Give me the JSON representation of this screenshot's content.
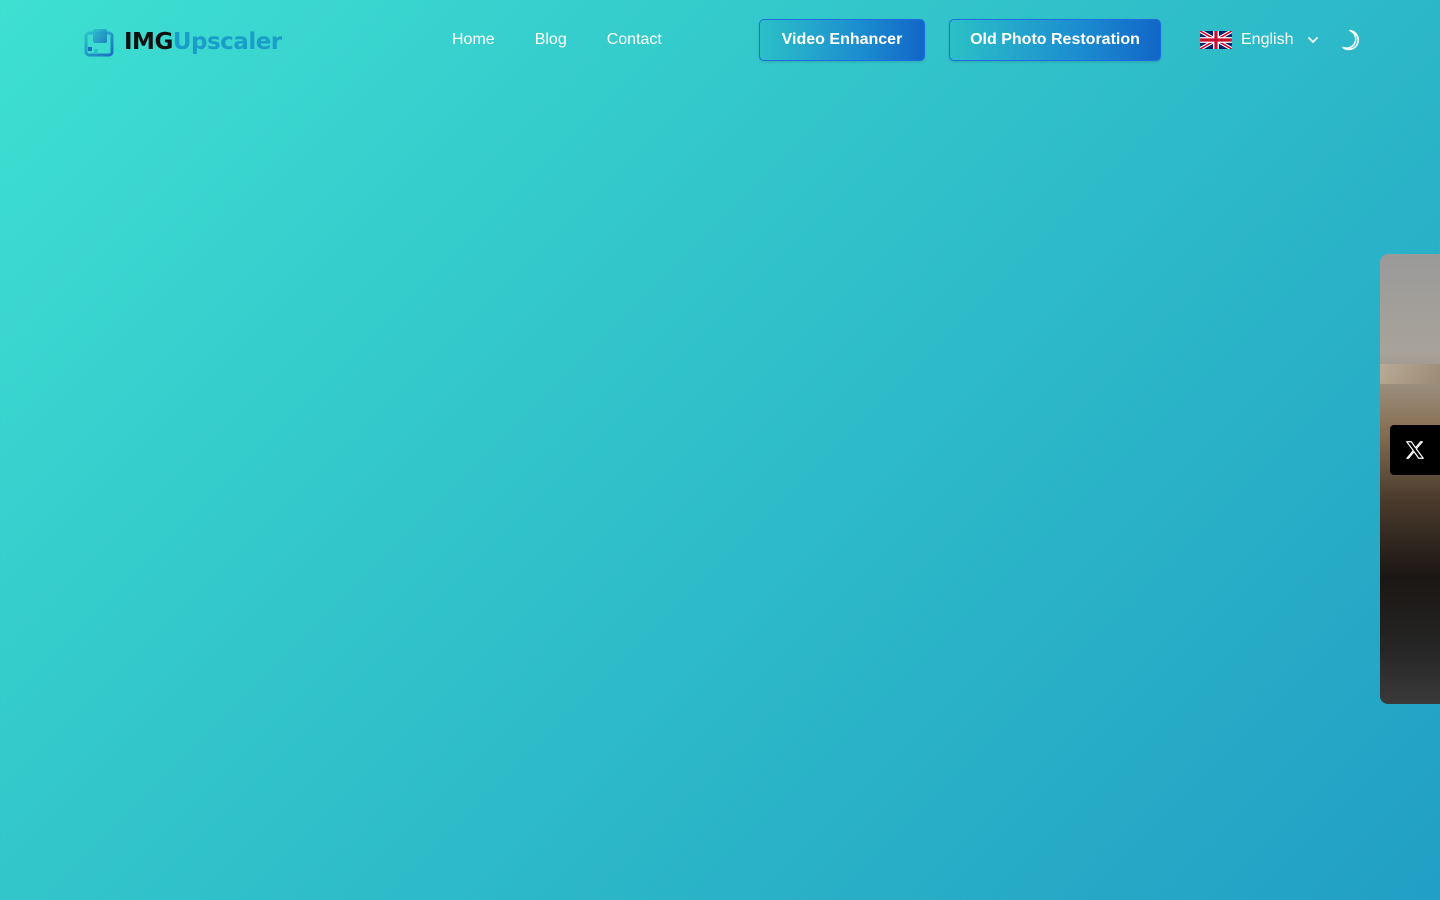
{
  "brand": {
    "name_part1": "IMG",
    "name_part2": "Upscaler",
    "logo_icon": "image-frame-icon"
  },
  "nav": {
    "items": [
      {
        "label": "Home"
      },
      {
        "label": "Blog"
      },
      {
        "label": "Contact"
      }
    ]
  },
  "actions": {
    "video_enhancer_label": "Video Enhancer",
    "old_photo_label": "Old Photo Restoration"
  },
  "language": {
    "selected": "English",
    "flag_icon": "uk-flag-icon"
  },
  "theme_toggle": {
    "icon": "moon-icon"
  },
  "share": {
    "icon": "x-twitter-icon"
  },
  "colors": {
    "background_start": "#3ee0d2",
    "background_end": "#219fc5",
    "button_border": "#1c6fe0",
    "brand_accent": "#1a9dc9"
  }
}
